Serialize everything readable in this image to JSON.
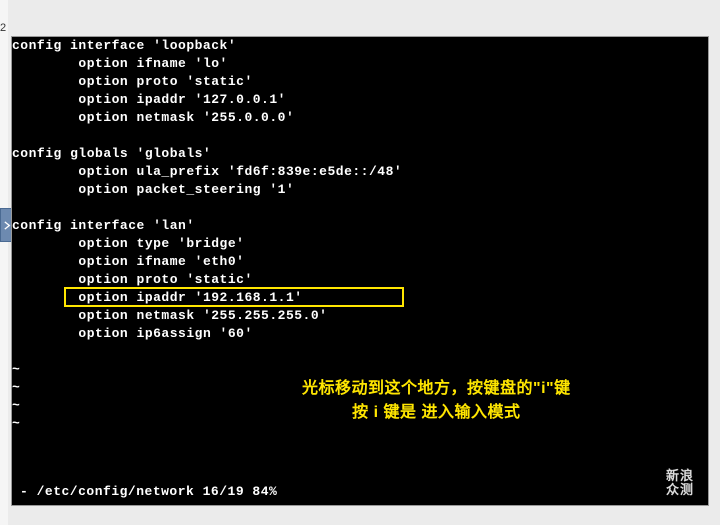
{
  "page_number": "2",
  "terminal": {
    "blocks": [
      {
        "header": "config interface 'loopback'",
        "options": [
          "option ifname 'lo'",
          "option proto 'static'",
          "option ipaddr '127.0.0.1'",
          "option netmask '255.0.0.0'"
        ]
      },
      {
        "header": "config globals 'globals'",
        "options": [
          "option ula_prefix 'fd6f:839e:e5de::/48'",
          "option packet_steering '1'"
        ]
      },
      {
        "header": "config interface 'lan'",
        "options": [
          "option type 'bridge'",
          "option ifname 'eth0'",
          "option proto 'static'",
          "option ipaddr '192.168.1.1'",
          "option netmask '255.255.255.0'",
          "option ip6assign '60'"
        ]
      }
    ],
    "highlighted_line": "option ipaddr '192.168.1.1'",
    "tilde_rows": [
      "~",
      "~",
      "~",
      "~"
    ],
    "status": "- /etc/config/network 16/19 84%"
  },
  "annotation": {
    "line1": "光标移动到这个地方，按键盘的\"i\"键",
    "line2": "按 i 键是 进入输入模式"
  },
  "watermark": {
    "line1": "新浪",
    "line2": "众测"
  },
  "colors": {
    "highlight": "#ffe600",
    "terminal_bg": "#000000",
    "terminal_fg": "#ffffff"
  }
}
